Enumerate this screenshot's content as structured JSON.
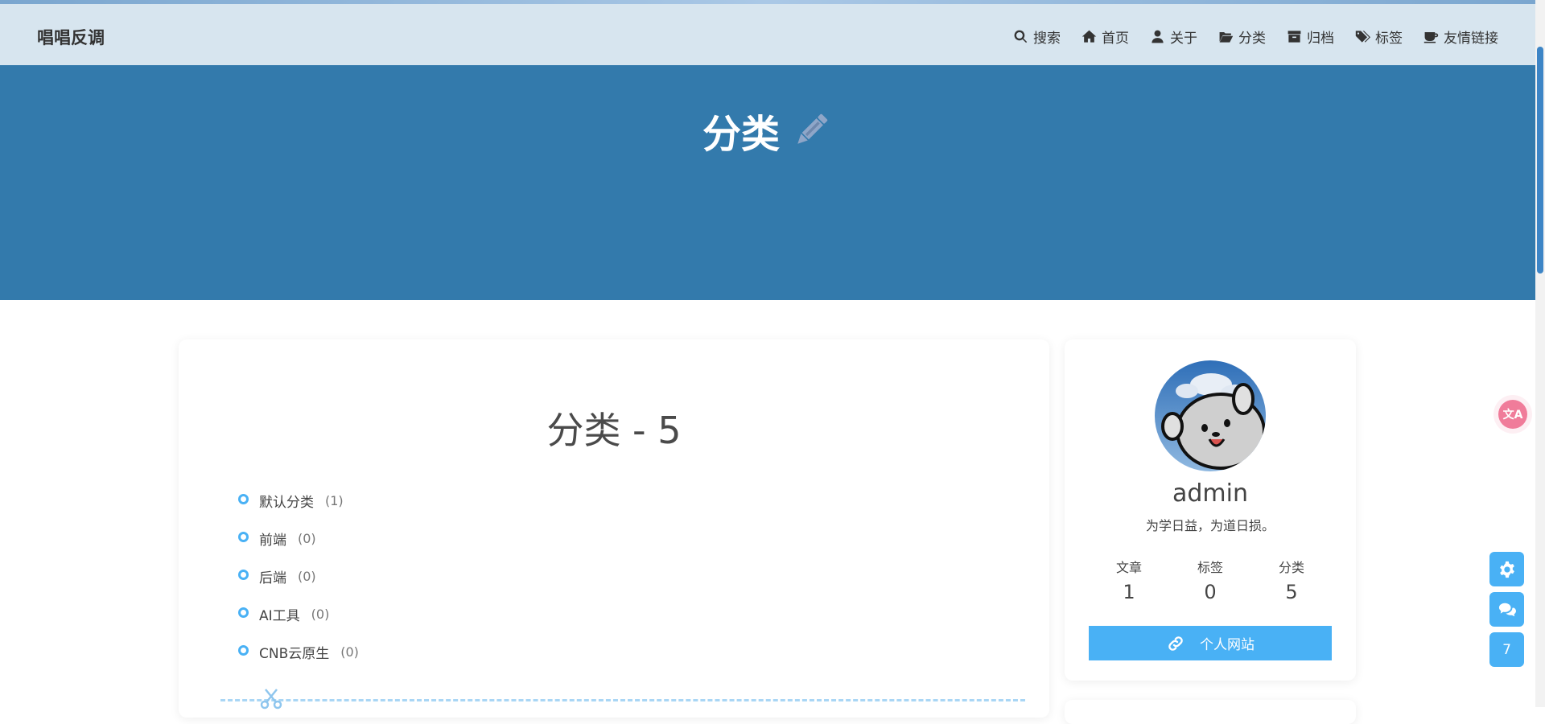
{
  "site": {
    "brand": "唱唱反调"
  },
  "nav": {
    "items": [
      {
        "label": "搜索",
        "icon": "search-icon"
      },
      {
        "label": "首页",
        "icon": "home-icon"
      },
      {
        "label": "关于",
        "icon": "user-icon"
      },
      {
        "label": "分类",
        "icon": "folder-open-icon"
      },
      {
        "label": "归档",
        "icon": "archive-icon"
      },
      {
        "label": "标签",
        "icon": "tags-icon"
      },
      {
        "label": "友情链接",
        "icon": "coffee-icon"
      }
    ]
  },
  "hero": {
    "title": "分类",
    "icon": "pencil-icon"
  },
  "categories": {
    "title": "分类 - 5",
    "items": [
      {
        "name": "默认分类",
        "count": "(1)"
      },
      {
        "name": "前端",
        "count": "(0)"
      },
      {
        "name": "后端",
        "count": "(0)"
      },
      {
        "name": "AI工具",
        "count": "(0)"
      },
      {
        "name": "CNB云原生",
        "count": "(0)"
      }
    ]
  },
  "profile": {
    "name": "admin",
    "motto": "为学日益，为道日损。",
    "stats": [
      {
        "label": "文章",
        "value": "1"
      },
      {
        "label": "标签",
        "value": "0"
      },
      {
        "label": "分类",
        "value": "5"
      }
    ],
    "button_label": "个人网站"
  },
  "floating": {
    "translate_label": "文A",
    "counter": "7"
  },
  "colors": {
    "accent": "#49b1f5",
    "hero_bg": "#337aac",
    "navbar_bg": "#d7e5ef",
    "translate": "#f07c9a"
  }
}
